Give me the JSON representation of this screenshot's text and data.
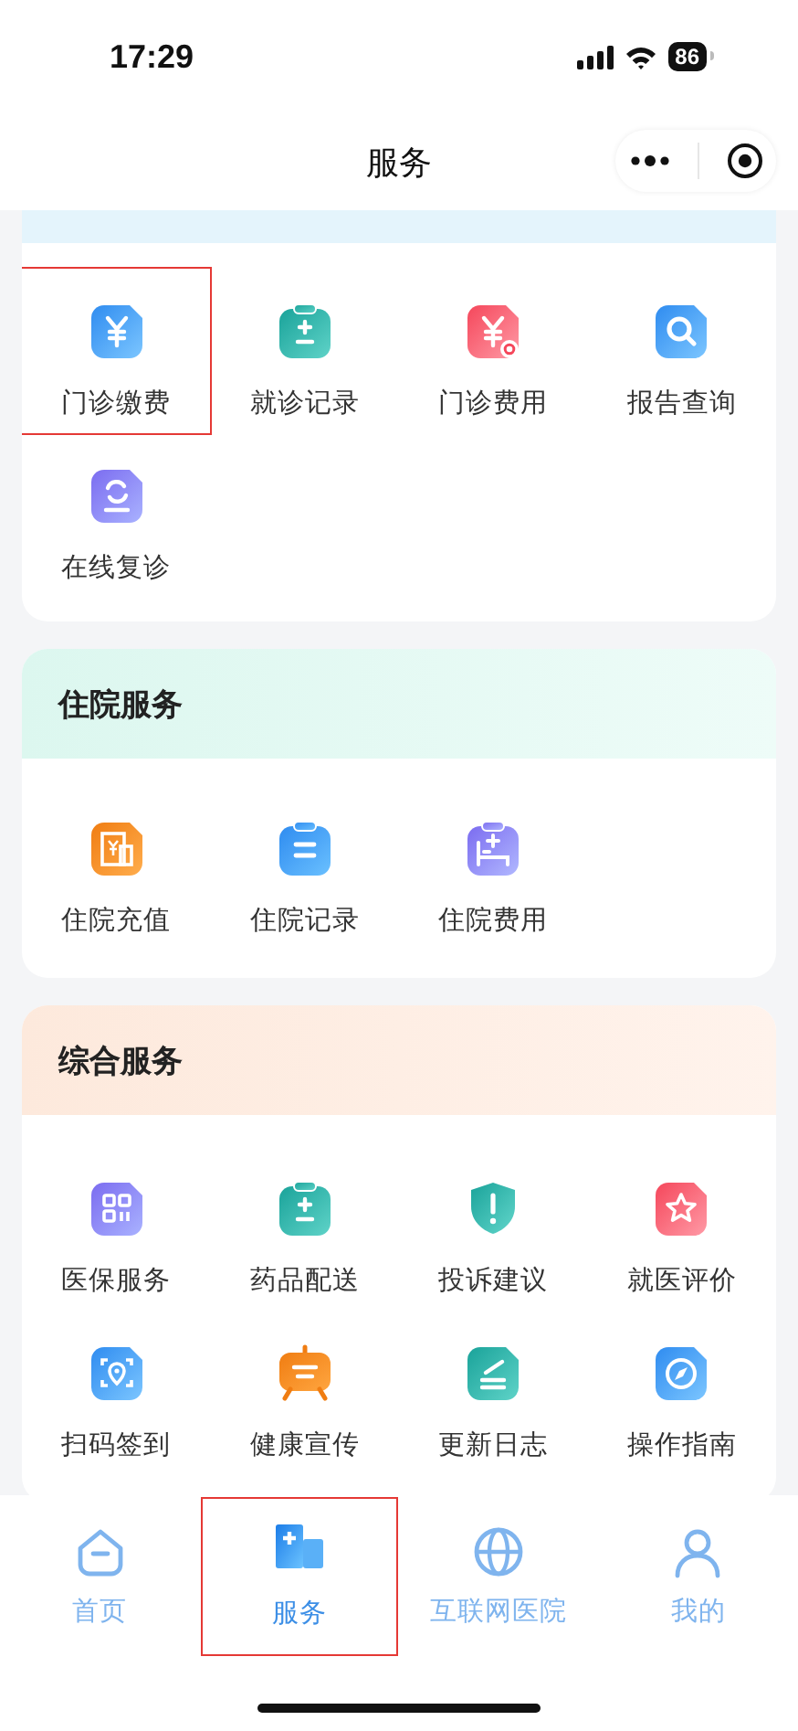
{
  "status_bar": {
    "time": "17:29",
    "battery": "86"
  },
  "nav_bar": {
    "title": "服务"
  },
  "sections": [
    {
      "items": [
        {
          "label": "门诊缴费",
          "highlighted": true
        },
        {
          "label": "就诊记录",
          "highlighted": false
        },
        {
          "label": "门诊费用",
          "highlighted": false
        },
        {
          "label": "报告查询",
          "highlighted": false
        },
        {
          "label": "在线复诊",
          "highlighted": false
        }
      ]
    },
    {
      "title": "住院服务",
      "items": [
        {
          "label": "住院充值",
          "highlighted": false
        },
        {
          "label": "住院记录",
          "highlighted": false
        },
        {
          "label": "住院费用",
          "highlighted": false
        }
      ]
    },
    {
      "title": "综合服务",
      "items": [
        {
          "label": "医保服务",
          "highlighted": false
        },
        {
          "label": "药品配送",
          "highlighted": false
        },
        {
          "label": "投诉建议",
          "highlighted": false
        },
        {
          "label": "就医评价",
          "highlighted": false
        },
        {
          "label": "扫码签到",
          "highlighted": false
        },
        {
          "label": "健康宣传",
          "highlighted": false
        },
        {
          "label": "更新日志",
          "highlighted": false
        },
        {
          "label": "操作指南",
          "highlighted": false
        }
      ]
    }
  ],
  "tab_bar": [
    {
      "label": "首页",
      "selected": false,
      "highlighted": false
    },
    {
      "label": "服务",
      "selected": true,
      "highlighted": true
    },
    {
      "label": "互联网医院",
      "selected": false,
      "highlighted": false
    },
    {
      "label": "我的",
      "selected": false,
      "highlighted": false
    }
  ]
}
